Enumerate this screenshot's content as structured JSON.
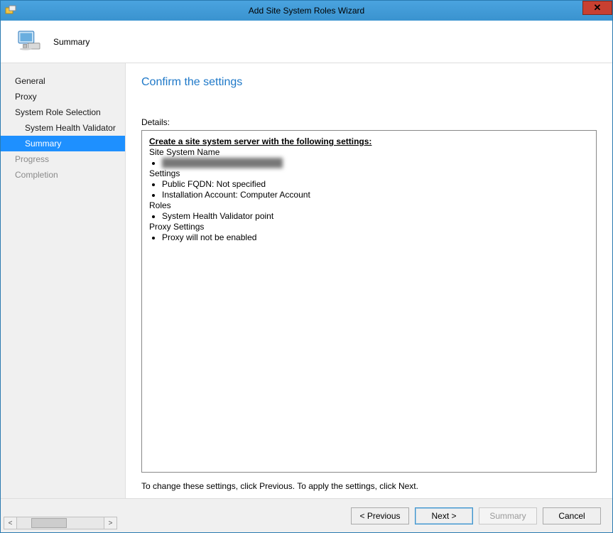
{
  "window": {
    "title": "Add Site System Roles Wizard"
  },
  "header": {
    "title": "Summary"
  },
  "nav": {
    "items": [
      {
        "label": "General"
      },
      {
        "label": "Proxy"
      },
      {
        "label": "System Role Selection"
      },
      {
        "label": "System Health Validator"
      },
      {
        "label": "Summary"
      },
      {
        "label": "Progress"
      },
      {
        "label": "Completion"
      }
    ]
  },
  "main": {
    "heading": "Confirm the settings",
    "details_label": "Details:",
    "section_title": "Create a site system server with the following settings:",
    "group_site_system_name": "Site System Name",
    "site_system_name_value_obscured": "obscured",
    "group_settings": "Settings",
    "settings_items": {
      "fqdn": "Public FQDN: Not specified",
      "install_account": "Installation Account: Computer Account"
    },
    "group_roles": "Roles",
    "roles_items": {
      "role1": "System Health Validator point"
    },
    "group_proxy": "Proxy Settings",
    "proxy_items": {
      "proxy1": "Proxy will not be enabled"
    },
    "hint": "To change these settings, click Previous. To apply the settings, click Next."
  },
  "buttons": {
    "previous": "< Previous",
    "next": "Next >",
    "summary": "Summary",
    "cancel": "Cancel"
  }
}
